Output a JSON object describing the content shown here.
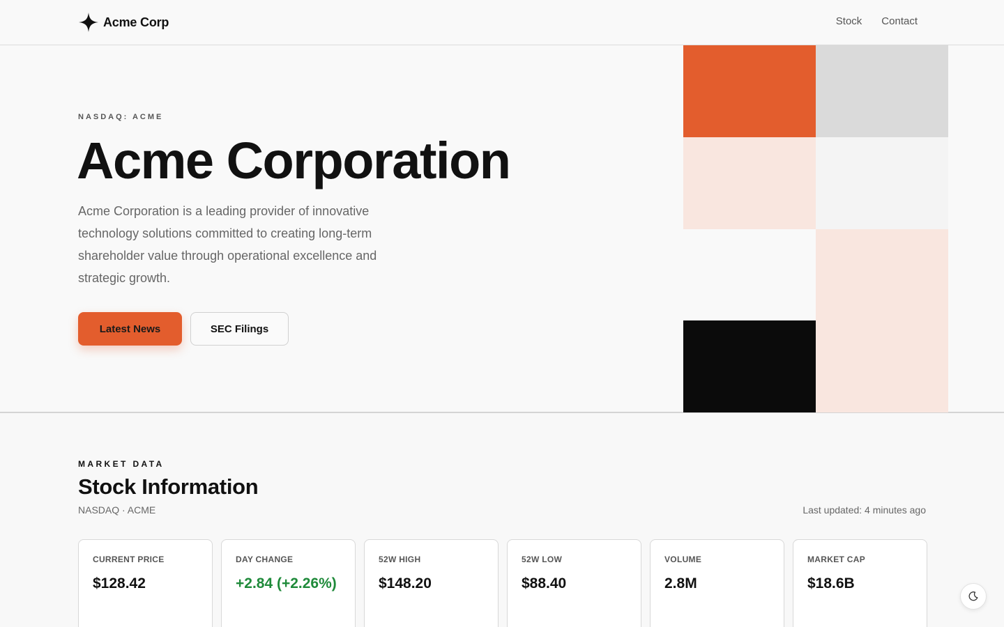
{
  "header": {
    "logo_text": "Acme Corp",
    "nav": [
      {
        "label": "Stock"
      },
      {
        "label": "Contact"
      }
    ]
  },
  "hero": {
    "ticker_label": "NASDAQ: ACME",
    "title": "Acme Corporation",
    "description": "Acme Corporation is a leading provider of innovative technology solutions committed to creating long-term shareholder value through operational excellence and strategic growth.",
    "primary_button": "Latest News",
    "secondary_button": "SEC Filings"
  },
  "colors": {
    "accent": "#e35d2d",
    "accent_light": "#f9e6df",
    "gray_tile": "#dadada",
    "light_tile": "#f4f4f4",
    "white_tile": "#f9f9f9",
    "dark_tile": "#0b0b0b",
    "positive": "#1f8a3a"
  },
  "stock": {
    "eyebrow": "MARKET DATA",
    "title": "Stock Information",
    "subtitle": "NASDAQ · ACME",
    "last_updated": "Last updated: 4 minutes ago",
    "cards": [
      {
        "label": "CURRENT PRICE",
        "value": "$128.42"
      },
      {
        "label": "DAY CHANGE",
        "value": "+2.84 (+2.26%)"
      },
      {
        "label": "52W HIGH",
        "value": "$148.20"
      },
      {
        "label": "52W LOW",
        "value": "$88.40"
      },
      {
        "label": "VOLUME",
        "value": "2.8M"
      },
      {
        "label": "MARKET CAP",
        "value": "$18.6B"
      }
    ]
  }
}
